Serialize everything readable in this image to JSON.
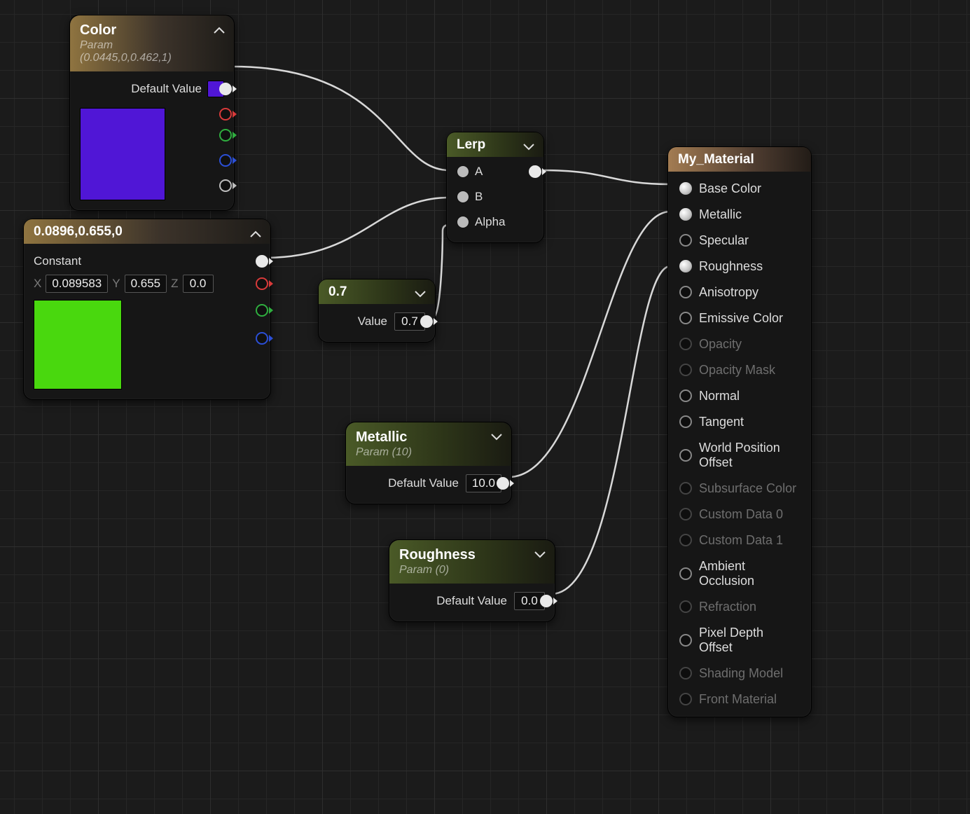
{
  "nodes": {
    "color": {
      "title": "Color",
      "subtitle": "Param (0.0445,0,0.462,1)",
      "default_label": "Default Value",
      "swatch_css": "#5016d6",
      "preview_css": "#5016d6"
    },
    "const3": {
      "title": "0.0896,0.655,0",
      "constant_label": "Constant",
      "x_label": "X",
      "x_val": "0.089583",
      "y_label": "Y",
      "y_val": "0.655",
      "z_label": "Z",
      "z_val": "0.0",
      "preview_css": "#49d80e"
    },
    "scalar07": {
      "title": "0.7",
      "value_label": "Value",
      "value": "0.7"
    },
    "lerp": {
      "title": "Lerp",
      "a": "A",
      "b": "B",
      "alpha": "Alpha"
    },
    "metallic": {
      "title": "Metallic",
      "subtitle": "Param (10)",
      "default_label": "Default Value",
      "value": "10.0"
    },
    "roughness": {
      "title": "Roughness",
      "subtitle": "Param (0)",
      "default_label": "Default Value",
      "value": "0.0"
    }
  },
  "material": {
    "title": "My_Material",
    "inputs": [
      {
        "label": "Base Color",
        "state": "active"
      },
      {
        "label": "Metallic",
        "state": "active"
      },
      {
        "label": "Specular",
        "state": "ring"
      },
      {
        "label": "Roughness",
        "state": "active"
      },
      {
        "label": "Anisotropy",
        "state": "ring"
      },
      {
        "label": "Emissive Color",
        "state": "ring"
      },
      {
        "label": "Opacity",
        "state": "dim"
      },
      {
        "label": "Opacity Mask",
        "state": "dim"
      },
      {
        "label": "Normal",
        "state": "ring"
      },
      {
        "label": "Tangent",
        "state": "ring"
      },
      {
        "label": "World Position Offset",
        "state": "ring"
      },
      {
        "label": "Subsurface Color",
        "state": "dim"
      },
      {
        "label": "Custom Data 0",
        "state": "dim"
      },
      {
        "label": "Custom Data 1",
        "state": "dim"
      },
      {
        "label": "Ambient Occlusion",
        "state": "ring"
      },
      {
        "label": "Refraction",
        "state": "dim"
      },
      {
        "label": "Pixel Depth Offset",
        "state": "ring"
      },
      {
        "label": "Shading Model",
        "state": "dim"
      },
      {
        "label": "Front Material",
        "state": "dim"
      }
    ]
  }
}
